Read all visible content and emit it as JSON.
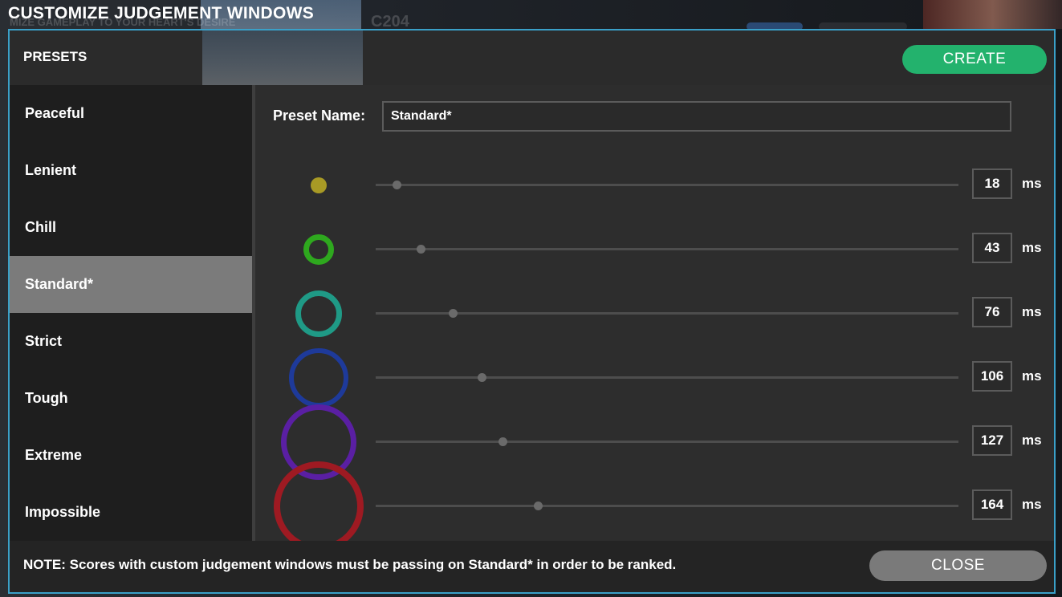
{
  "window_title": "CUSTOMIZE JUDGEMENT WINDOWS",
  "background": {
    "song_code": "C204",
    "subtitle": "MIZE GAMEPLAY TO YOUR HEART'S DESIRE"
  },
  "header": {
    "presets_label": "PRESETS",
    "create_label": "CREATE",
    "accent_color": "#23b26d"
  },
  "presets": [
    {
      "label": "Peaceful",
      "selected": false
    },
    {
      "label": "Lenient",
      "selected": false
    },
    {
      "label": "Chill",
      "selected": false
    },
    {
      "label": "Standard*",
      "selected": true
    },
    {
      "label": "Strict",
      "selected": false
    },
    {
      "label": "Tough",
      "selected": false
    },
    {
      "label": "Extreme",
      "selected": false
    },
    {
      "label": "Impossible",
      "selected": false
    }
  ],
  "editor": {
    "preset_name_label": "Preset Name:",
    "preset_name_value": "Standard*",
    "slider_max_ms": 600,
    "judgements": [
      {
        "value": "18",
        "unit": "ms",
        "ms": 18,
        "color": "#a89a25",
        "icon": "solid-dot-icon"
      },
      {
        "value": "43",
        "unit": "ms",
        "ms": 43,
        "color": "#2ea81e",
        "icon": "ring-icon"
      },
      {
        "value": "76",
        "unit": "ms",
        "ms": 76,
        "color": "#1f9a86",
        "icon": "ring-icon"
      },
      {
        "value": "106",
        "unit": "ms",
        "ms": 106,
        "color": "#1e3a9a",
        "icon": "ring-icon"
      },
      {
        "value": "127",
        "unit": "ms",
        "ms": 127,
        "color": "#5a1fa3",
        "icon": "ring-icon"
      },
      {
        "value": "164",
        "unit": "ms",
        "ms": 164,
        "color": "#9e1a22",
        "icon": "ring-icon"
      }
    ]
  },
  "footer": {
    "note": "NOTE: Scores with custom judgement windows must be passing on Standard* in order to be ranked.",
    "close_label": "CLOSE"
  },
  "frame_color": "#3aa0c8"
}
